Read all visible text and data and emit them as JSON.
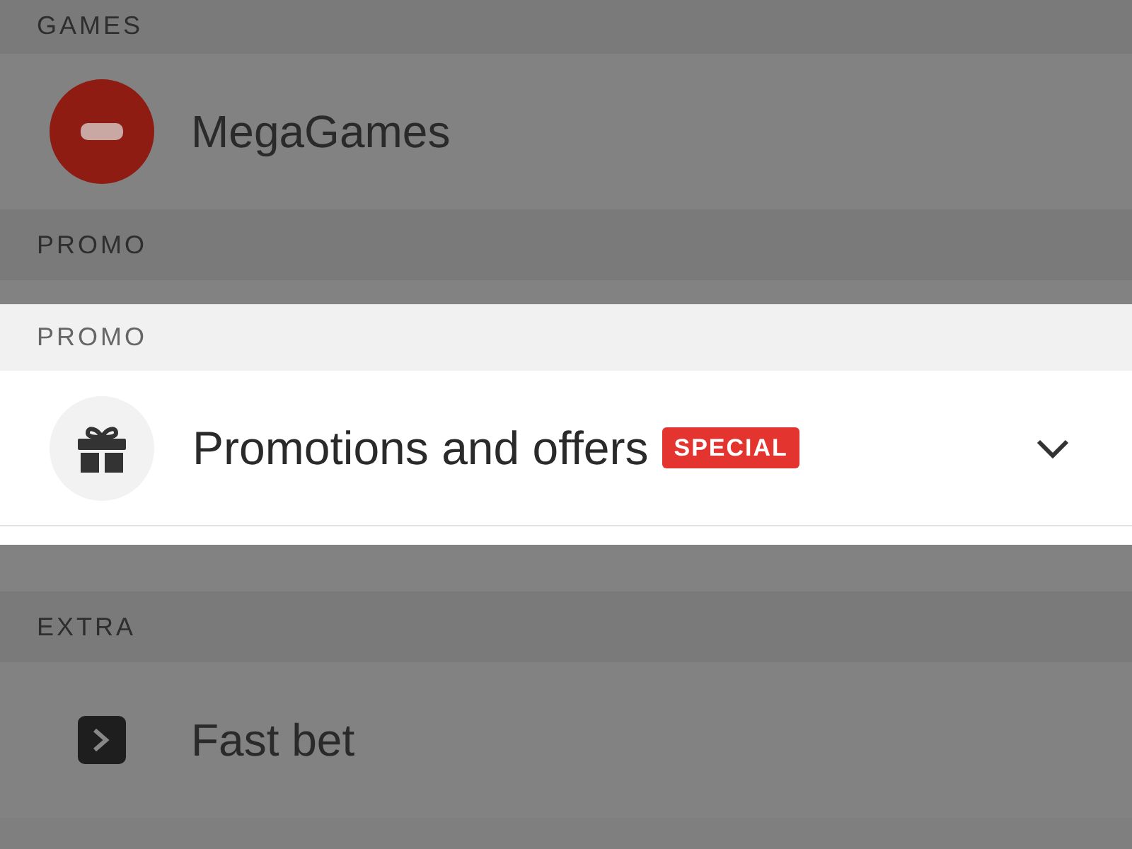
{
  "background_list": [
    {
      "kind": "header",
      "label": "GAMES"
    },
    {
      "kind": "item",
      "label": "MegaGames"
    },
    {
      "kind": "header",
      "label": "PROMO"
    },
    {
      "kind": "spacer"
    },
    {
      "kind": "header",
      "label": "EXTRA"
    },
    {
      "kind": "item",
      "label": "Fast bet"
    }
  ],
  "highlight": {
    "header": "PROMO",
    "item": {
      "label": "Promotions and offers",
      "badge": "SPECIAL",
      "expanded": false
    }
  }
}
